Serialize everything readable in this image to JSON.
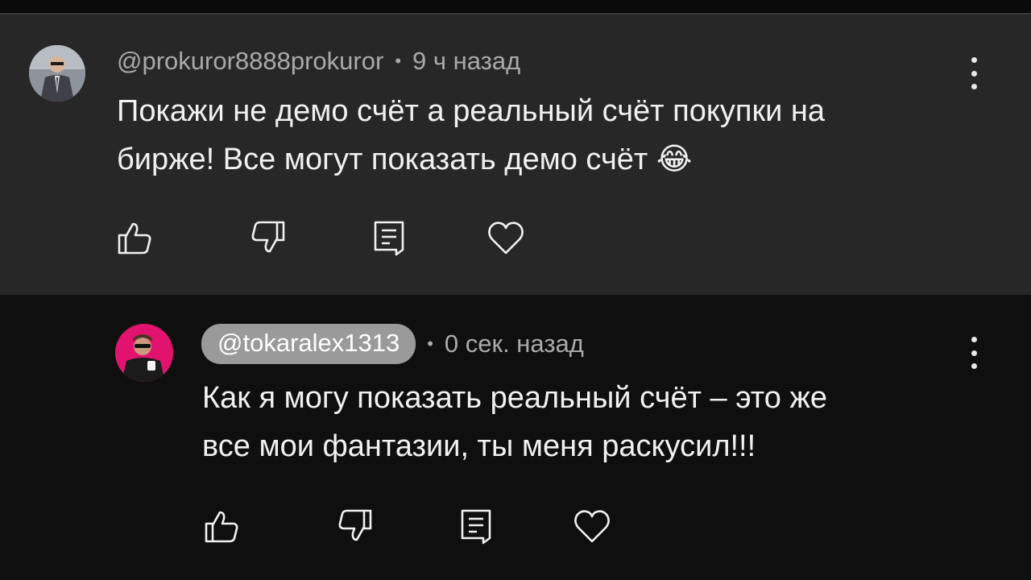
{
  "comments": [
    {
      "author": "@prokuror8888prokuror",
      "separator": "•",
      "time": "9 ч назад",
      "text_line1": "Покажи не демо счёт а реальный счёт покупки на",
      "text_line2": "бирже! Все могут показать демо счёт 😂"
    },
    {
      "author": "@tokaralex1313",
      "separator": "•",
      "time": "0 сек. назад",
      "text_line1": "Как я могу показать реальный счёт – это же",
      "text_line2": "все мои фантазии, ты меня раскусил!!!"
    }
  ],
  "actions": [
    "like",
    "dislike",
    "reply",
    "heart"
  ],
  "icons": {
    "like": "thumbs-up-icon",
    "dislike": "thumbs-down-icon",
    "reply": "comment-icon",
    "heart": "heart-icon",
    "more": "more-vertical-icon"
  },
  "colors": {
    "top_comment_bg": "#272727",
    "reply_bg": "#0f0f0f",
    "meta_text": "#aaaaaa",
    "author_chip_bg": "#9a9a9a",
    "avatar2_bg": "#e2136e"
  }
}
